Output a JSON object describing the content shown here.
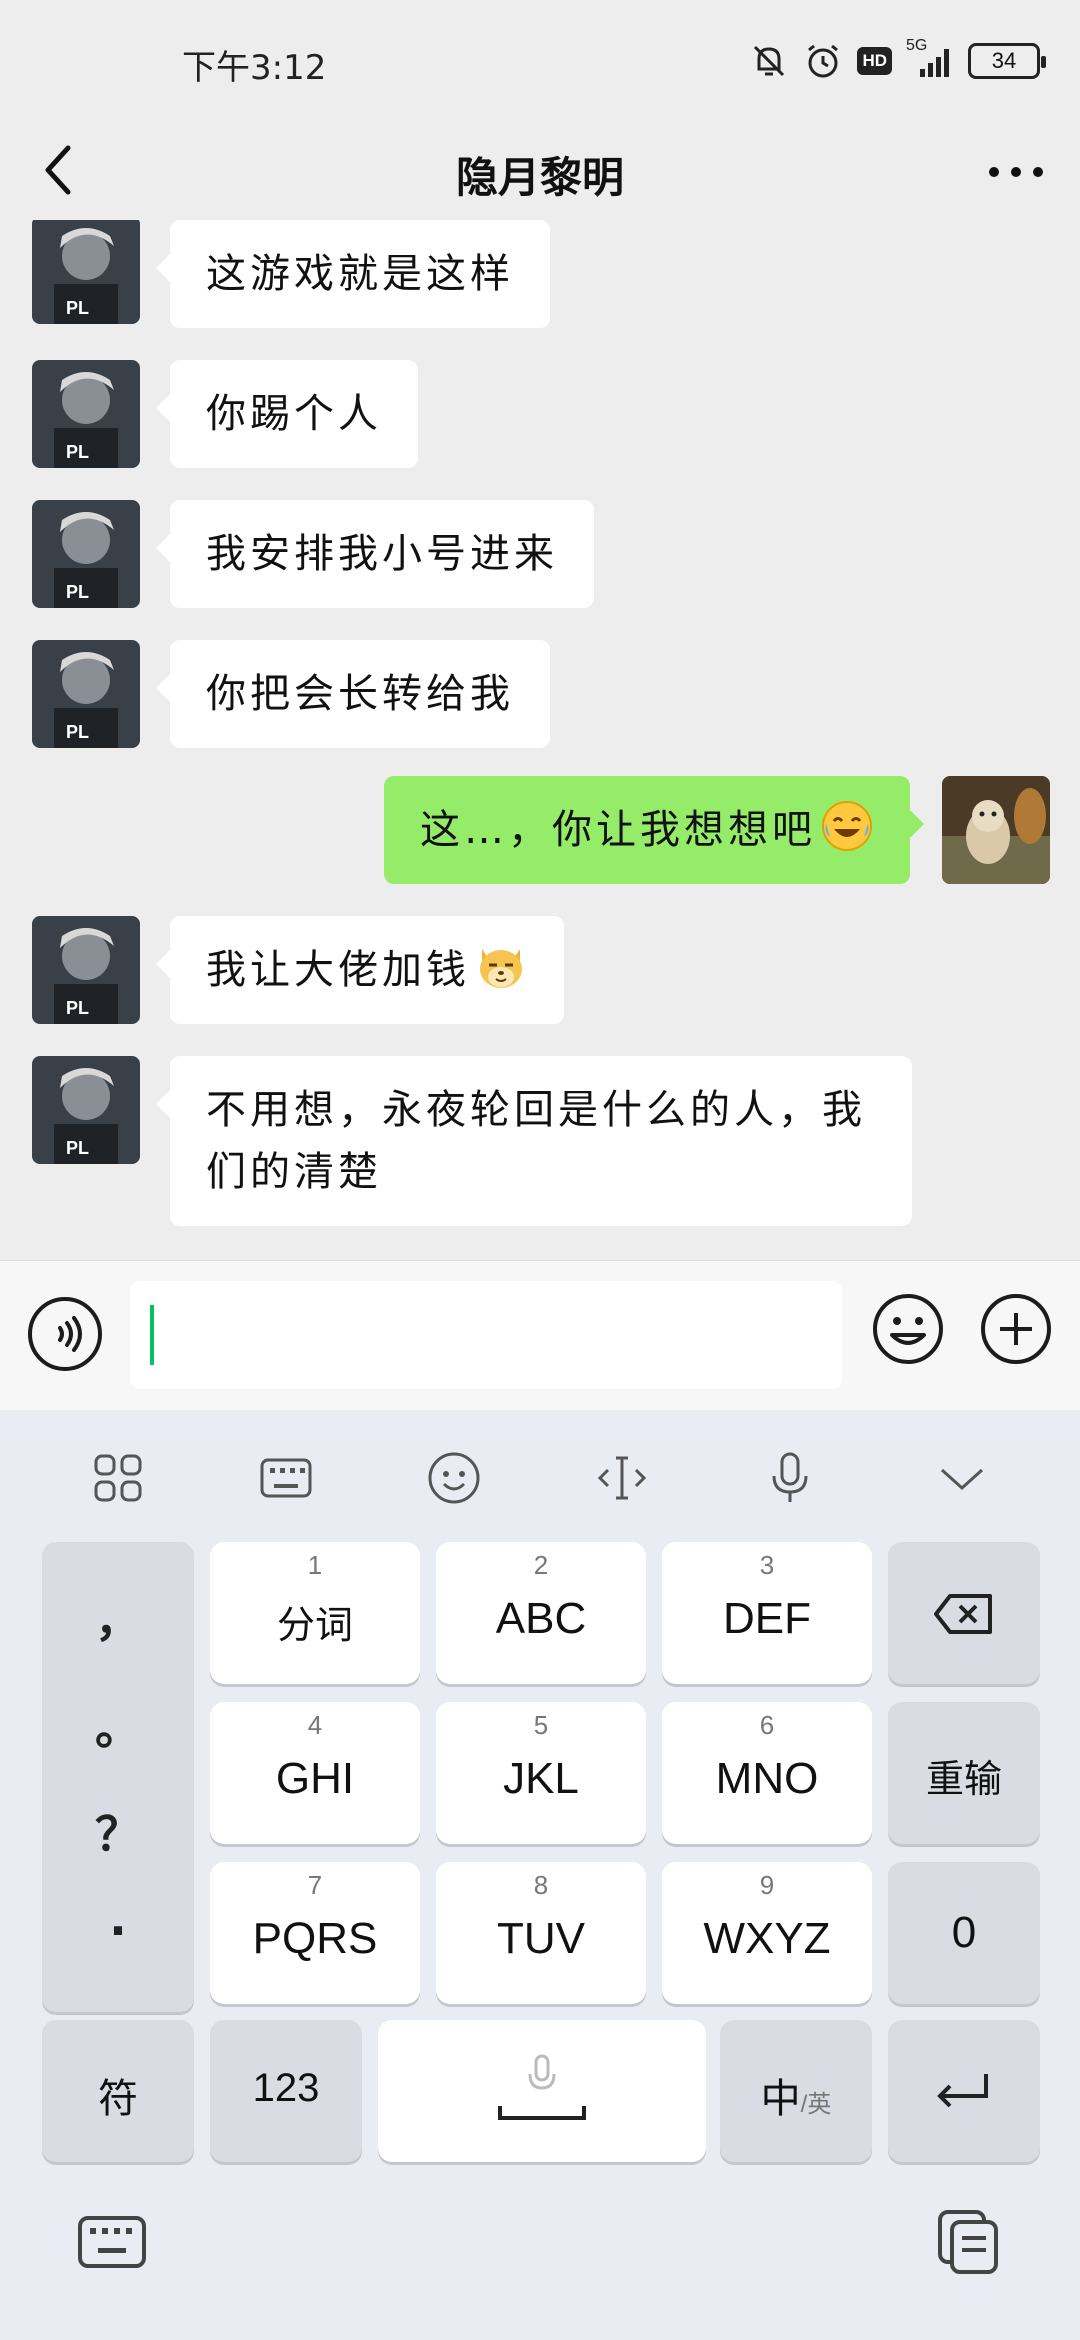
{
  "status": {
    "time": "下午3:12",
    "network": "5G",
    "hd": "HD",
    "battery": "34"
  },
  "header": {
    "title": "隐月黎明"
  },
  "avatars": {
    "other_overlay": "PL"
  },
  "messages": [
    {
      "side": "in",
      "text": "这游戏就是这样"
    },
    {
      "side": "in",
      "text": "你踢个人"
    },
    {
      "side": "in",
      "text": "我安排我小号进来"
    },
    {
      "side": "in",
      "text": "你把会长转给我"
    },
    {
      "side": "out",
      "text": "这…，你让我想想吧",
      "emoji": "laughing-crying-emoji"
    },
    {
      "side": "in",
      "text": "我让大佬加钱",
      "emoji": "doge-emoji"
    },
    {
      "side": "in",
      "text": "不用想，永夜轮回是什么的人，我们的清楚"
    }
  ],
  "input": {
    "value": ""
  },
  "keyboard": {
    "punct": [
      "，",
      "。",
      "？",
      "."
    ],
    "rows": [
      [
        {
          "num": "1",
          "label": "分词"
        },
        {
          "num": "2",
          "label": "ABC"
        },
        {
          "num": "3",
          "label": "DEF"
        }
      ],
      [
        {
          "num": "4",
          "label": "GHI"
        },
        {
          "num": "5",
          "label": "JKL"
        },
        {
          "num": "6",
          "label": "MNO"
        }
      ],
      [
        {
          "num": "7",
          "label": "PQRS"
        },
        {
          "num": "8",
          "label": "TUV"
        },
        {
          "num": "9",
          "label": "WXYZ"
        }
      ]
    ],
    "reinput": "重输",
    "zero": "0",
    "symbols": "符",
    "num_switch": "123",
    "lang_main": "中",
    "lang_alt": "/英"
  },
  "colors": {
    "outgoing_bubble": "#95ec69",
    "incoming_bubble": "#ffffff",
    "caret": "#07c160",
    "chat_bg": "#ededed"
  }
}
